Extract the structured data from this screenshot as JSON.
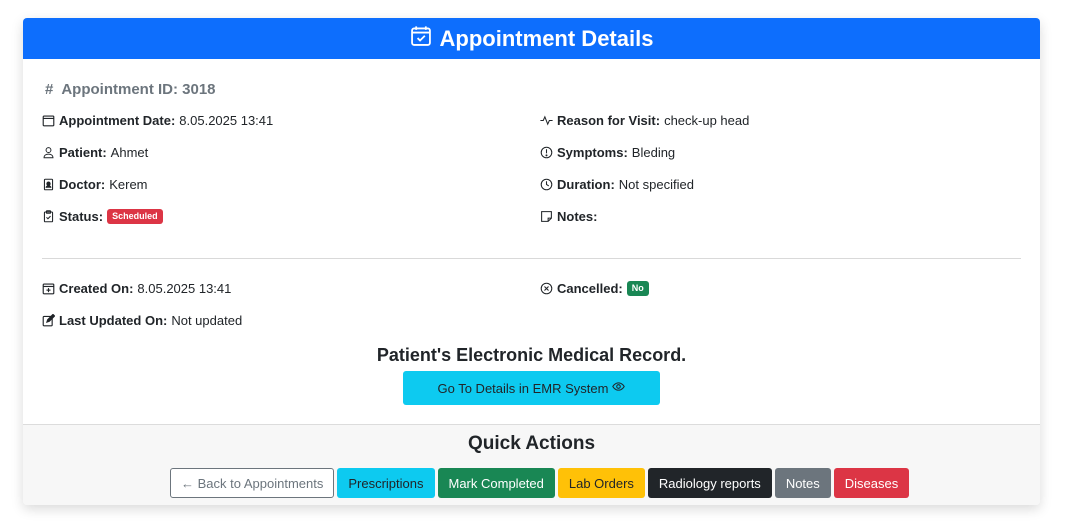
{
  "header": {
    "title": "Appointment Details",
    "icon": "calendar-check-icon"
  },
  "appointment": {
    "id_label": "Appointment ID: 3018",
    "left_fields": [
      {
        "label": "Appointment Date:",
        "value": "8.05.2025 13:41",
        "icon": "calendar-icon"
      },
      {
        "label": "Patient:",
        "value": "Ahmet",
        "icon": "person-icon"
      },
      {
        "label": "Doctor:",
        "value": "Kerem",
        "icon": "badge-icon"
      },
      {
        "label": "Status:",
        "badge": "Scheduled",
        "icon": "clipboard-icon"
      }
    ],
    "right_fields": [
      {
        "label": "Reason for Visit:",
        "value": "check-up head",
        "icon": "activity-icon"
      },
      {
        "label": "Symptoms:",
        "value": "Bleding",
        "icon": "exclamation-circle-icon"
      },
      {
        "label": "Duration:",
        "value": "Not specified",
        "icon": "clock-icon"
      },
      {
        "label": "Notes:",
        "value": "",
        "icon": "sticky-note-icon"
      }
    ],
    "meta_left": [
      {
        "label": "Created On:",
        "value": "8.05.2025 13:41",
        "icon": "calendar-plus-icon"
      },
      {
        "label": "Last Updated On:",
        "value": "Not updated",
        "icon": "pencil-square-icon"
      }
    ],
    "meta_right": [
      {
        "label": "Cancelled:",
        "badge": "No",
        "icon": "x-circle-icon"
      }
    ]
  },
  "emr": {
    "title": "Patient's Electronic Medical Record.",
    "button_label": "Go To Details in EMR System"
  },
  "quick_actions": {
    "title": "Quick Actions",
    "buttons": [
      {
        "label": "← Back to Appointments",
        "style": "outline"
      },
      {
        "label": "Prescriptions",
        "style": "info"
      },
      {
        "label": "Mark Completed",
        "style": "success"
      },
      {
        "label": "Lab Orders",
        "style": "warning"
      },
      {
        "label": "Radiology reports",
        "style": "dark"
      },
      {
        "label": "Notes",
        "style": "secondary"
      },
      {
        "label": "Diseases",
        "style": "danger"
      }
    ]
  },
  "colors": {
    "primary": "#0d6efd",
    "info": "#0dcaf0",
    "success": "#198754",
    "warning": "#ffc107",
    "danger": "#dc3545",
    "dark": "#212529",
    "secondary": "#6c757d"
  }
}
